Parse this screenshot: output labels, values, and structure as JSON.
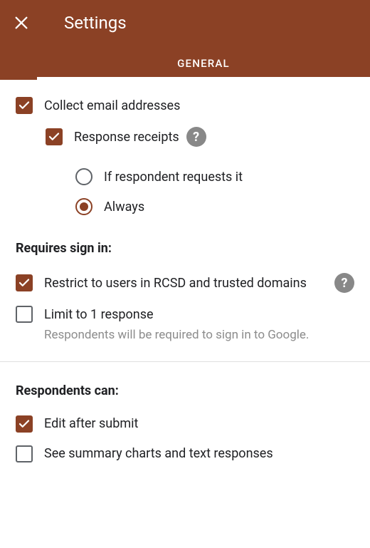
{
  "header": {
    "title": "Settings",
    "tabs": {
      "general": "GENERAL"
    }
  },
  "options": {
    "collectEmail": {
      "label": "Collect email addresses",
      "checked": true
    },
    "responseReceipts": {
      "label": "Response receipts",
      "checked": true,
      "radio": {
        "ifRequests": "If respondent requests it",
        "always": "Always",
        "selected": "always"
      }
    }
  },
  "sections": {
    "signin": {
      "title": "Requires sign in:",
      "restrict": {
        "label": "Restrict to users in RCSD and trusted domains",
        "checked": true
      },
      "limit": {
        "label": "Limit to 1 response",
        "checked": false,
        "subtext": "Respondents will be required to sign in to Google."
      }
    },
    "respondents": {
      "title": "Respondents can:",
      "edit": {
        "label": "Edit after submit",
        "checked": true
      },
      "summary": {
        "label": "See summary charts and text responses",
        "checked": false
      }
    }
  }
}
